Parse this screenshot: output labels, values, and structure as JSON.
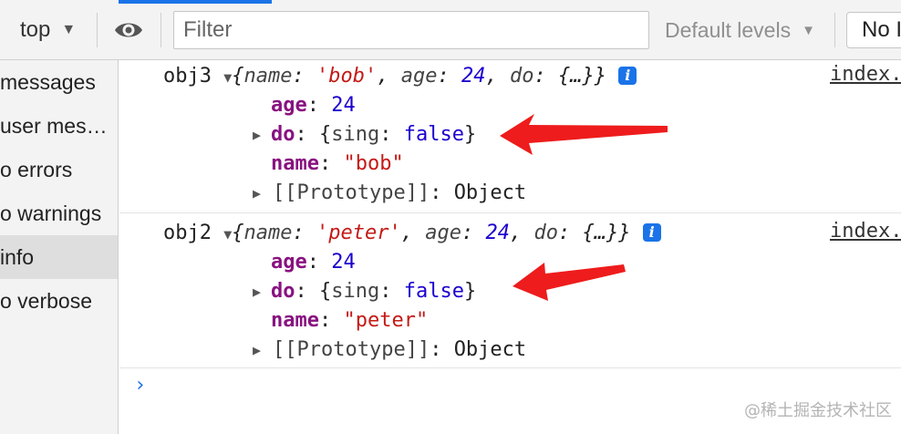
{
  "toolbar": {
    "context_label": "top",
    "filter_placeholder": "Filter",
    "levels_label": "Default levels",
    "issues_label": "No I"
  },
  "sidebar": {
    "items": [
      {
        "label": "messages",
        "selected": false
      },
      {
        "label": "user mes…",
        "selected": false
      },
      {
        "label": "o errors",
        "selected": false
      },
      {
        "label": "o warnings",
        "selected": false
      },
      {
        "label": "info",
        "selected": true
      },
      {
        "label": "o verbose",
        "selected": false
      }
    ]
  },
  "messages": [
    {
      "var": "obj3",
      "summary": {
        "name": "'bob'",
        "age": "24",
        "do": "{…}"
      },
      "props": {
        "age_key": "age",
        "age_val": "24",
        "do_key": "do",
        "do_inner_key": "sing",
        "do_inner_val": "false",
        "name_key": "name",
        "name_val": "\"bob\"",
        "proto_key": "[[Prototype]]",
        "proto_val": "Object"
      },
      "source": "index."
    },
    {
      "var": "obj2",
      "summary": {
        "name": "'peter'",
        "age": "24",
        "do": "{…}"
      },
      "props": {
        "age_key": "age",
        "age_val": "24",
        "do_key": "do",
        "do_inner_key": "sing",
        "do_inner_val": "false",
        "name_key": "name",
        "name_val": "\"peter\"",
        "proto_key": "[[Prototype]]",
        "proto_val": "Object"
      },
      "source": "index."
    }
  ],
  "info_icon_glyph": "i",
  "prompt_glyph": "›",
  "watermark": "@稀土掘金技术社区",
  "colors": {
    "accent": "#1a73e8",
    "annotation_arrow": "#ee1c1c",
    "string": "#c41a16",
    "number": "#1c00cf",
    "key": "#881280"
  }
}
